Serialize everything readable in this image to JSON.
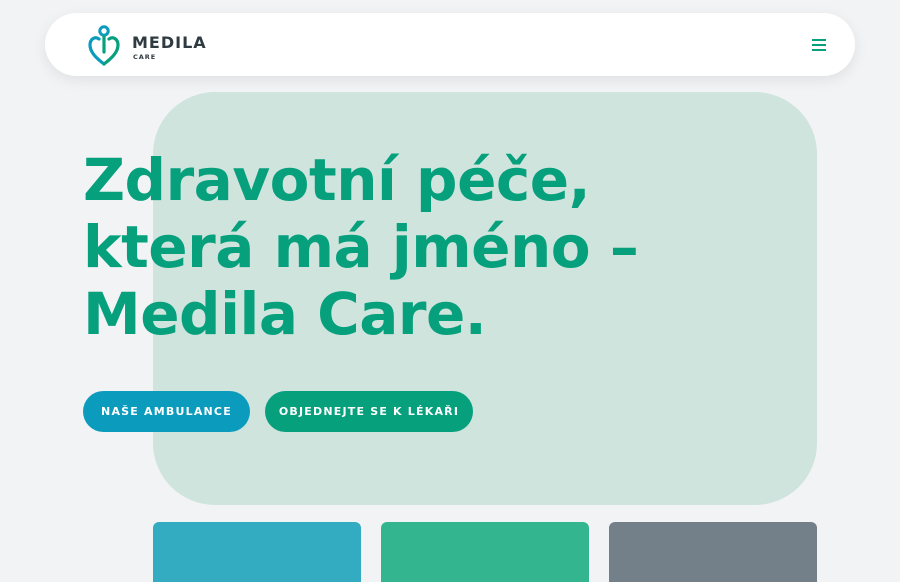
{
  "colors": {
    "background": "#f2f3f5",
    "brand_green": "#06a07d",
    "brand_blue": "#0b9bbd",
    "hero_blob": "#cfe4dd"
  },
  "header": {
    "logo": {
      "name": "MEDILA",
      "sub": "CARE",
      "icon": "medila-heart-logo-icon"
    },
    "menu_icon": "hamburger-menu-icon"
  },
  "hero": {
    "title": "Zdravotní péče, která má jméno – Medila Care.",
    "buttons": {
      "ambulance": "NAŠE AMBULANCE",
      "order": "OBJEDNEJTE SE K LÉKAŘI"
    }
  },
  "cards": [
    {
      "color": "#33abc0"
    },
    {
      "color": "#33b68f"
    },
    {
      "color": "#737f89"
    }
  ]
}
